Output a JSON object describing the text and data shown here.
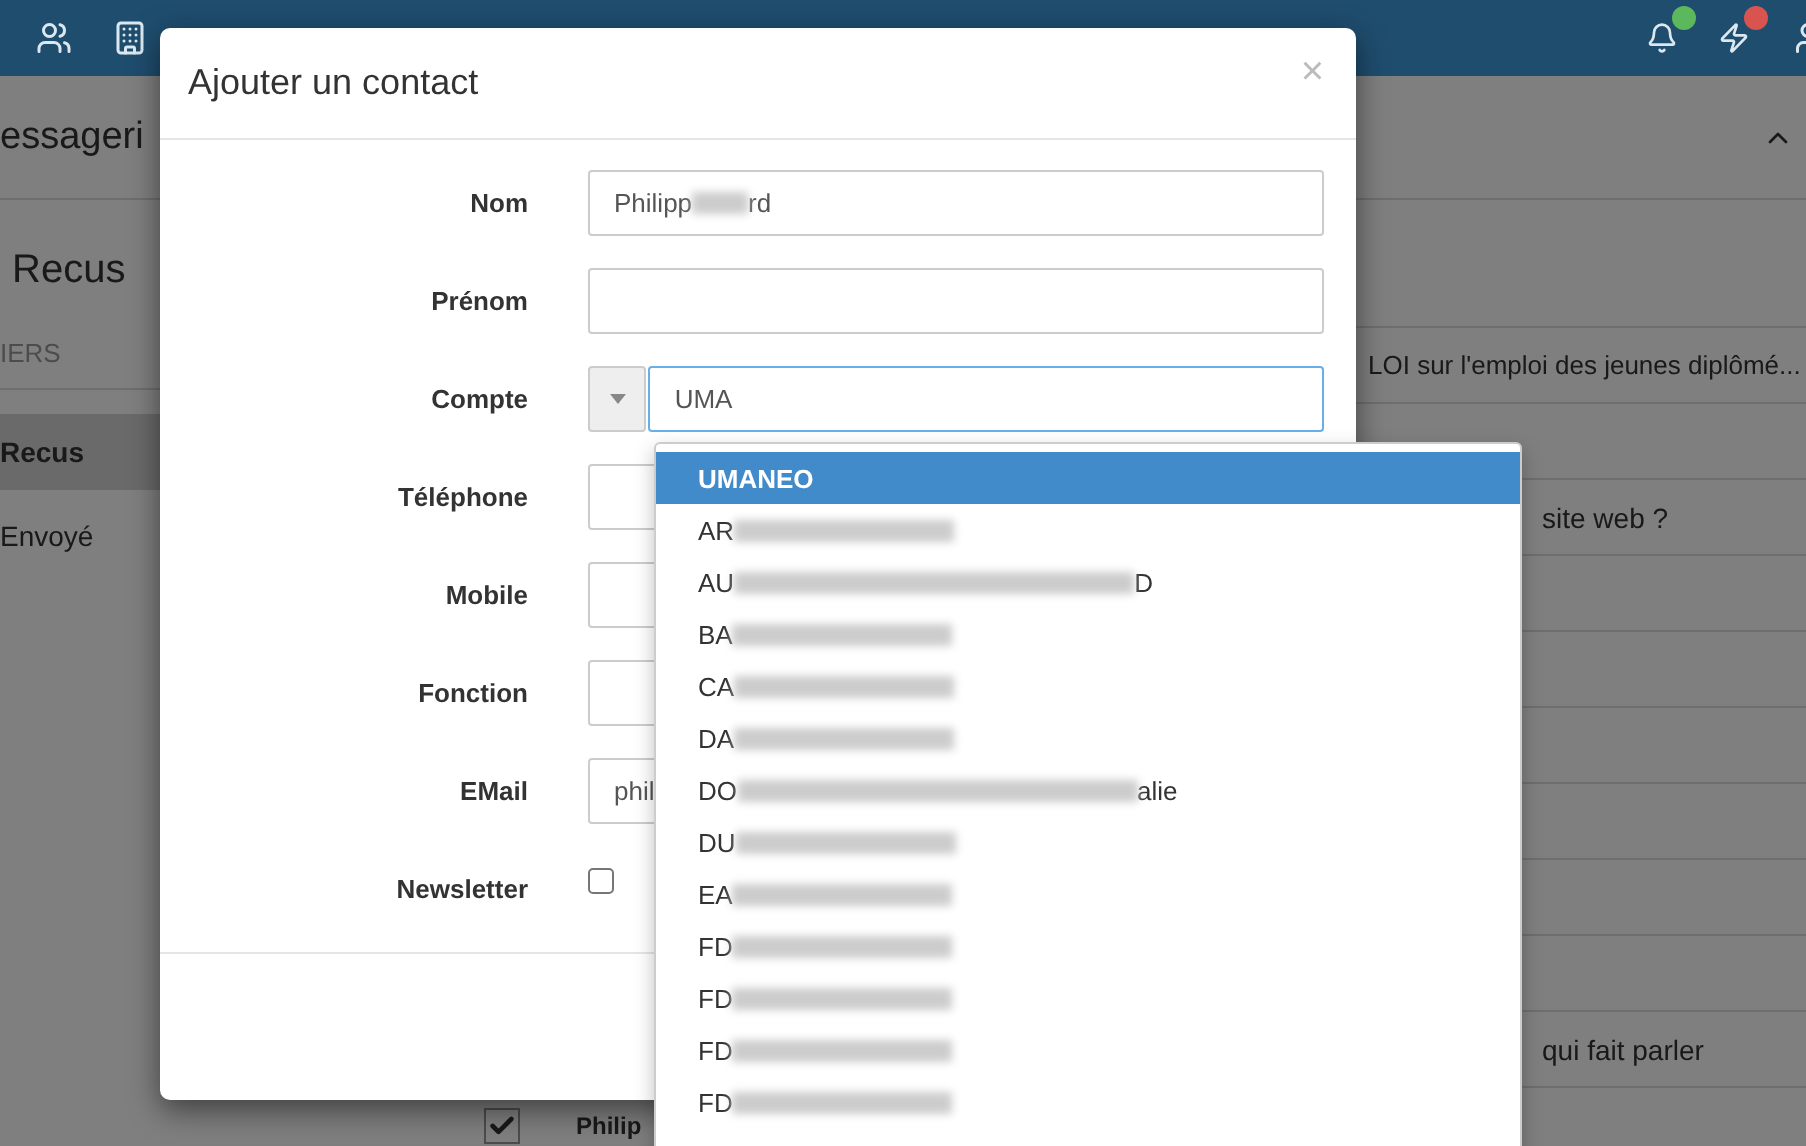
{
  "page": {
    "title": "essageri",
    "folder_title": "Recus",
    "folders_heading": "IERS"
  },
  "folders": [
    {
      "label": "Recus",
      "selected": true
    },
    {
      "label": "Envoyé",
      "selected": false
    }
  ],
  "notifications": [
    {
      "color": "#5cb85c"
    },
    {
      "color": "#d9534f"
    }
  ],
  "message_rows": [
    {
      "kind": "subject",
      "text": "LOI sur l'emploi des jeunes diplômé..."
    },
    {
      "kind": "blank"
    },
    {
      "kind": "subject_tail",
      "text": "site web ?"
    },
    {
      "kind": "blank"
    },
    {
      "kind": "blank"
    },
    {
      "kind": "blank"
    },
    {
      "kind": "blank"
    },
    {
      "kind": "blank"
    },
    {
      "kind": "blank"
    },
    {
      "kind": "subject_tail",
      "text": "qui fait parler"
    },
    {
      "kind": "sender",
      "text": "Philip",
      "checked": true
    }
  ],
  "dialog": {
    "title": "Ajouter un contact",
    "close": "×",
    "fields": [
      {
        "label": "Nom",
        "kind": "text",
        "value": "Philipp",
        "value_end": "rd",
        "redacted": true
      },
      {
        "label": "Prénom",
        "kind": "text"
      },
      {
        "label": "Compte",
        "kind": "combo",
        "value": "UMA",
        "focused": true
      },
      {
        "label": "Téléphone",
        "kind": "text"
      },
      {
        "label": "Mobile",
        "kind": "text"
      },
      {
        "label": "Fonction",
        "kind": "text"
      },
      {
        "label": "EMail",
        "kind": "text",
        "value": "phil"
      },
      {
        "label": "Newsletter",
        "kind": "checkbox",
        "checked": false
      }
    ]
  },
  "suggestions": [
    {
      "text": "UMANEO",
      "selected": true
    },
    {
      "text": "AR",
      "redacted": true,
      "selected": false
    },
    {
      "text": "AU",
      "redacted": true,
      "end": "D",
      "selected": false
    },
    {
      "text": "BA",
      "redacted": true,
      "selected": false
    },
    {
      "text": "CA",
      "redacted": true,
      "selected": false
    },
    {
      "text": "DA",
      "redacted": true,
      "selected": false
    },
    {
      "text": "DO",
      "redacted": true,
      "end": "alie",
      "selected": false
    },
    {
      "text": "DU",
      "redacted": true,
      "selected": false
    },
    {
      "text": "EA",
      "redacted": true,
      "selected": false
    },
    {
      "text": "FD",
      "redacted": true,
      "selected": false
    },
    {
      "text": "FD",
      "redacted": true,
      "selected": false
    },
    {
      "text": "FD",
      "redacted": true,
      "selected": false
    },
    {
      "text": "FD",
      "redacted": true,
      "selected": false
    }
  ]
}
